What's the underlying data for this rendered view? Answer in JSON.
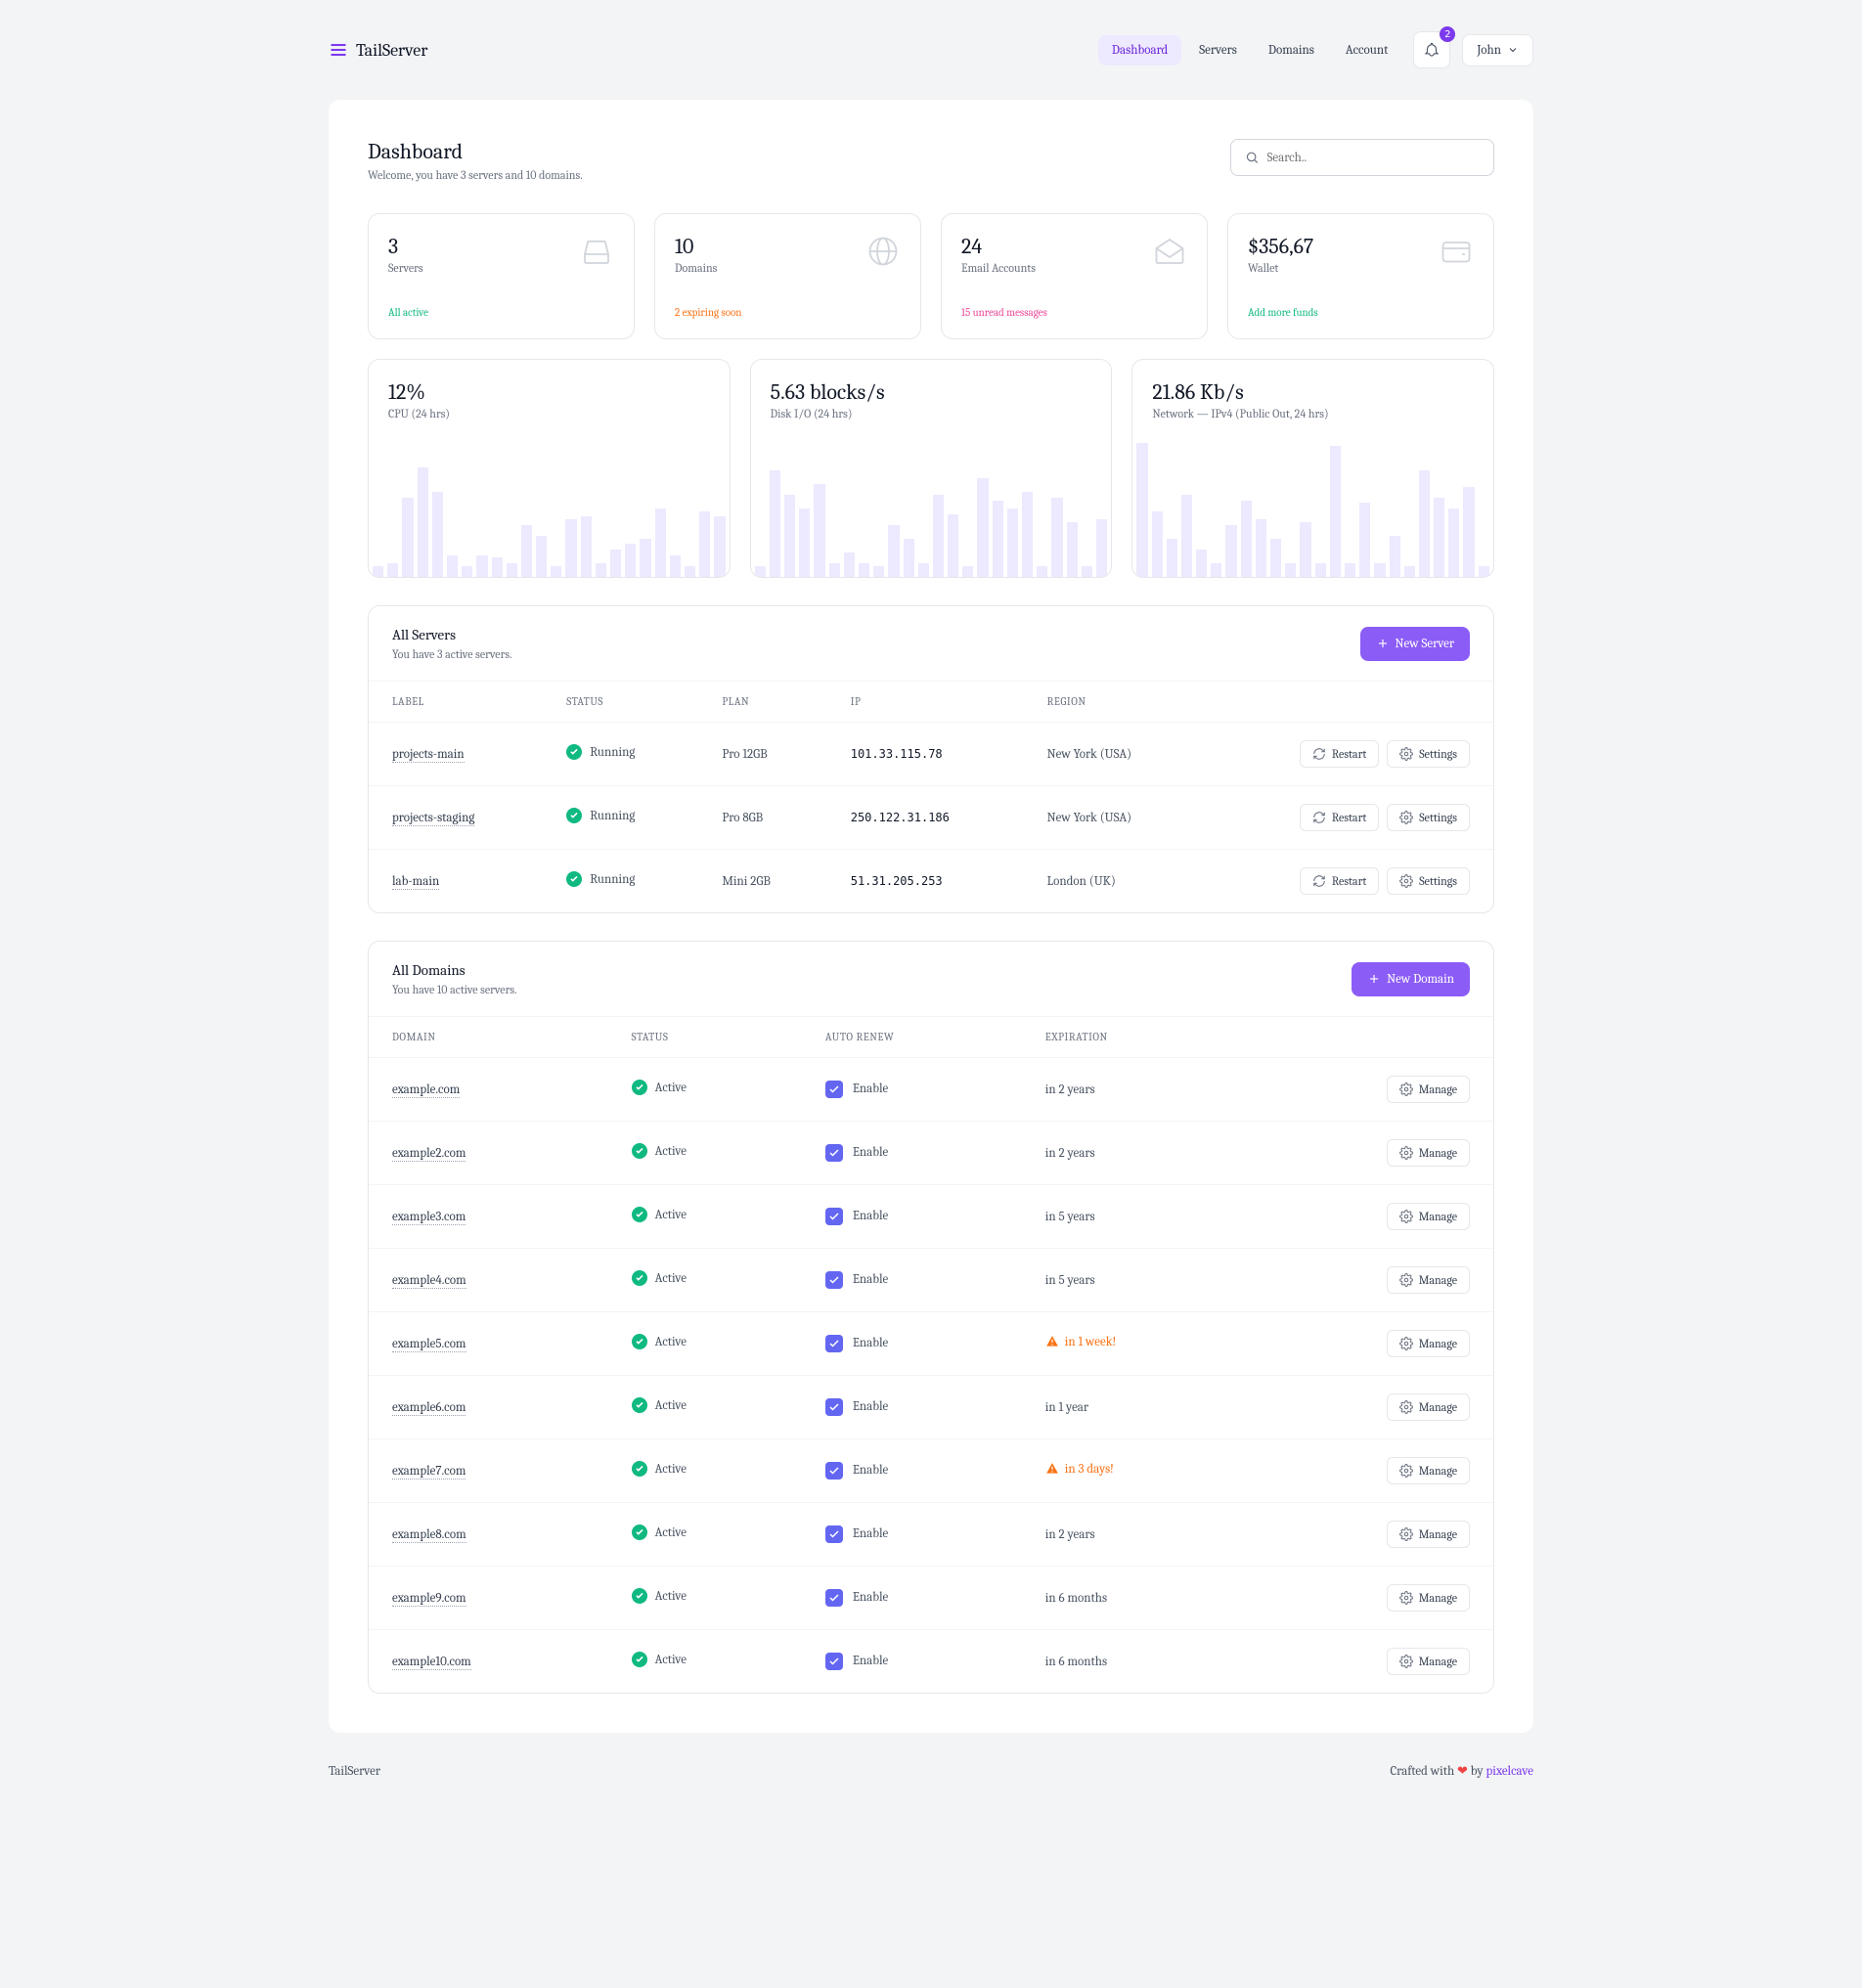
{
  "brand": "TailServer",
  "nav": {
    "dashboard": "Dashboard",
    "servers": "Servers",
    "domains": "Domains",
    "account": "Account"
  },
  "notif_count": "2",
  "user_name": "John",
  "page": {
    "title": "Dashboard",
    "subtitle": "Welcome, you have 3 servers and 10 domains."
  },
  "search_placeholder": "Search..",
  "stats": {
    "servers": {
      "value": "3",
      "label": "Servers",
      "foot": "All active"
    },
    "domains": {
      "value": "10",
      "label": "Domains",
      "foot": "2 expiring soon"
    },
    "emails": {
      "value": "24",
      "label": "Email Accounts",
      "foot": "15 unread messages"
    },
    "wallet": {
      "value": "$356,67",
      "label": "Wallet",
      "foot": "Add more funds"
    }
  },
  "charts": {
    "cpu": {
      "value": "12%",
      "label": "CPU (24 hrs)"
    },
    "disk": {
      "value": "5.63 blocks/s",
      "label": "Disk I/O (24 hrs)"
    },
    "net": {
      "value": "21.86 Kb/s",
      "label": "Network — IPv4 (Public Out, 24 hrs)"
    }
  },
  "chart_data": [
    {
      "type": "bar",
      "title": "CPU (24 hrs)",
      "value_label": "12%",
      "values": [
        8,
        10,
        58,
        80,
        62,
        16,
        8,
        16,
        14,
        10,
        38,
        30,
        8,
        42,
        44,
        10,
        20,
        24,
        28,
        50,
        16,
        8,
        48,
        44
      ]
    },
    {
      "type": "bar",
      "title": "Disk I/O (24 hrs)",
      "value_label": "5.63 blocks/s",
      "values": [
        8,
        78,
        60,
        50,
        68,
        10,
        18,
        10,
        8,
        38,
        28,
        10,
        60,
        46,
        8,
        72,
        56,
        50,
        62,
        8,
        58,
        40,
        8,
        42
      ]
    },
    {
      "type": "bar",
      "title": "Network — IPv4 (Public Out, 24 hrs)",
      "value_label": "21.86 Kb/s",
      "values": [
        98,
        48,
        28,
        60,
        20,
        10,
        38,
        56,
        42,
        28,
        10,
        40,
        10,
        96,
        10,
        54,
        10,
        30,
        8,
        78,
        58,
        50,
        66,
        8
      ]
    }
  ],
  "servers_section": {
    "title": "All Servers",
    "subtitle": "You have 3 active servers.",
    "new_btn": "New Server",
    "headers": {
      "label": "Label",
      "status": "Status",
      "plan": "Plan",
      "ip": "IP",
      "region": "Region"
    },
    "restart": "Restart",
    "settings": "Settings",
    "rows": [
      {
        "label": "projects-main",
        "status": "Running",
        "plan": "Pro 12GB",
        "ip": "101.33.115.78",
        "region": "New York (USA)"
      },
      {
        "label": "projects-staging",
        "status": "Running",
        "plan": "Pro 8GB",
        "ip": "250.122.31.186",
        "region": "New York (USA)"
      },
      {
        "label": "lab-main",
        "status": "Running",
        "plan": "Mini 2GB",
        "ip": "51.31.205.253",
        "region": "London (UK)"
      }
    ]
  },
  "domains_section": {
    "title": "All Domains",
    "subtitle": "You have 10 active servers.",
    "new_btn": "New Domain",
    "headers": {
      "domain": "Domain",
      "status": "Status",
      "auto_renew": "Auto Renew",
      "expiration": "Expiration"
    },
    "enable": "Enable",
    "manage": "Manage",
    "active": "Active",
    "rows": [
      {
        "domain": "example.com",
        "expiration": "in 2 years",
        "warn": false
      },
      {
        "domain": "example2.com",
        "expiration": "in 2 years",
        "warn": false
      },
      {
        "domain": "example3.com",
        "expiration": "in 5 years",
        "warn": false
      },
      {
        "domain": "example4.com",
        "expiration": "in 5 years",
        "warn": false
      },
      {
        "domain": "example5.com",
        "expiration": "in 1 week!",
        "warn": true
      },
      {
        "domain": "example6.com",
        "expiration": "in 1 year",
        "warn": false
      },
      {
        "domain": "example7.com",
        "expiration": "in 3 days!",
        "warn": true
      },
      {
        "domain": "example8.com",
        "expiration": "in 2 years",
        "warn": false
      },
      {
        "domain": "example9.com",
        "expiration": "in 6 months",
        "warn": false
      },
      {
        "domain": "example10.com",
        "expiration": "in 6 months",
        "warn": false
      }
    ]
  },
  "footer": {
    "brand": "TailServer",
    "text_a": "Crafted with ",
    "text_b": " by ",
    "link": "pixelcave"
  }
}
